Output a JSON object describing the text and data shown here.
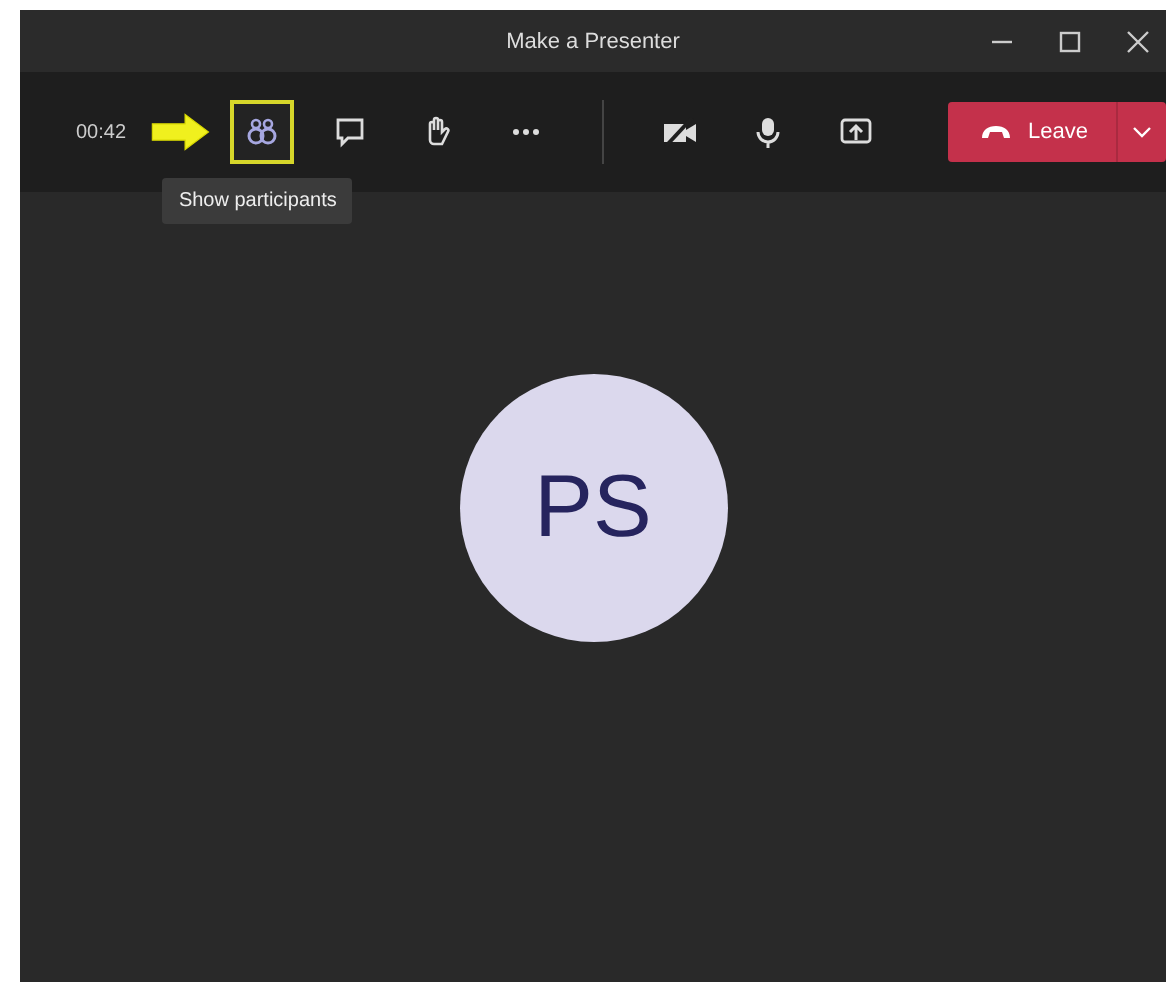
{
  "window": {
    "title": "Make a Presenter"
  },
  "toolbar": {
    "timer": "00:42",
    "buttons": [
      {
        "kind": "participants",
        "highlighted": true
      },
      {
        "kind": "chat",
        "highlighted": false
      },
      {
        "kind": "hand",
        "highlighted": false
      },
      {
        "kind": "more",
        "highlighted": false
      },
      {
        "kind": "camera",
        "highlighted": false
      },
      {
        "kind": "mic",
        "highlighted": false
      },
      {
        "kind": "share",
        "highlighted": false
      }
    ],
    "tooltip": "Show participants",
    "leave_button": {
      "label": "Leave"
    }
  },
  "stage": {
    "avatar_initials": "PS"
  }
}
